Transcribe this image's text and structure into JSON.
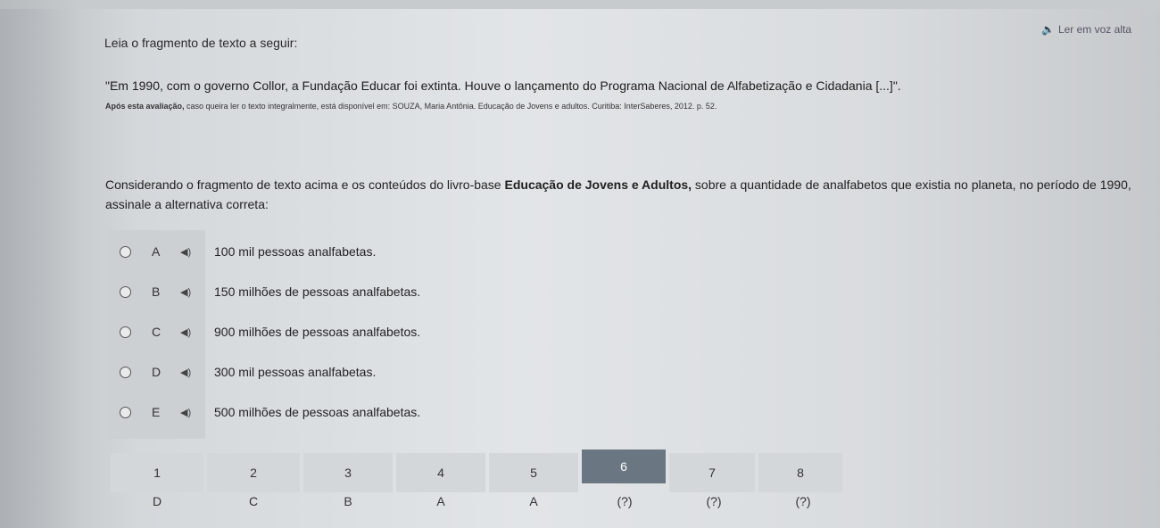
{
  "header": {
    "read_aloud": "Ler em voz alta"
  },
  "intro": "Leia o fragmento de texto a seguir:",
  "quote": "\"Em 1990, com o governo Collor, a Fundação Educar foi extinta. Houve o lançamento do Programa Nacional de Alfabetização e Cidadania [...]\".",
  "source": {
    "bold": "Após esta avaliação,",
    "rest": " caso queira ler o texto integralmente, está disponível em: SOUZA, Maria Antônia. Educação de Jovens e adultos. Curitiba: InterSaberes, 2012. p. 52."
  },
  "question": {
    "before": "Considerando o fragmento de texto acima e os conteúdos do livro-base ",
    "book": "Educação de Jovens e Adultos,",
    "after": " sobre a quantidade de analfabetos que existia no planeta, no período de 1990, assinale a alternativa correta:"
  },
  "options": [
    {
      "letter": "A",
      "text": "100 mil pessoas analfabetas."
    },
    {
      "letter": "B",
      "text": "150 milhões de pessoas analfabetas."
    },
    {
      "letter": "C",
      "text": "900 milhões de pessoas analfabetos."
    },
    {
      "letter": "D",
      "text": "300 mil pessoas analfabetas."
    },
    {
      "letter": "E",
      "text": "500 milhões de pessoas analfabetas."
    }
  ],
  "navigation": {
    "questions": [
      "1",
      "2",
      "3",
      "4",
      "5",
      "6",
      "7",
      "8"
    ],
    "answers": [
      "D",
      "C",
      "B",
      "A",
      "A",
      "(?)",
      "(?)",
      "(?)"
    ],
    "current": "6"
  },
  "colors": {
    "active_tab": "#6a7782",
    "tab": "#d3d7da",
    "option_strip": "#ccd0d3"
  }
}
